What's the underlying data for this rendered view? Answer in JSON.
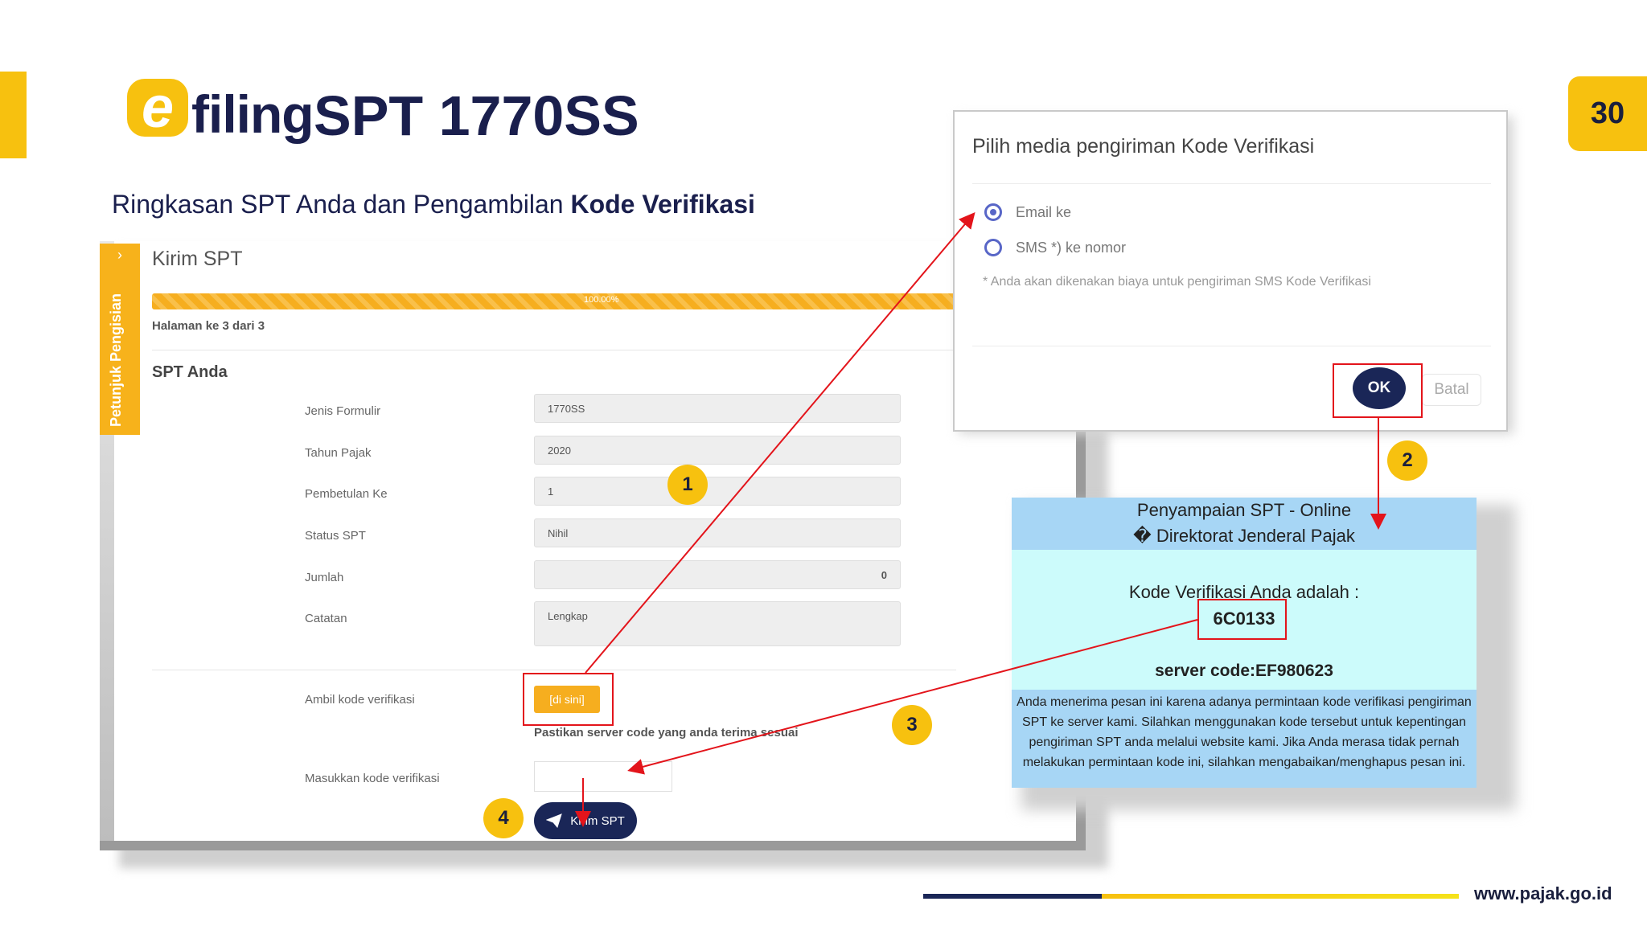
{
  "slide": {
    "page_number": "30",
    "logo_letter": "e",
    "logo_word": "filing",
    "title": "SPT 1770SS",
    "subtitle_plain": "Ringkasan SPT Anda dan Pengambilan ",
    "subtitle_bold": "Kode Verifikasi",
    "website": "www.pajak.go.id"
  },
  "form": {
    "guide_chevron": "›",
    "guide_tab": "Petunjuk Pengisian",
    "title": "Kirim SPT",
    "progress": {
      "label": "100.00%",
      "percent": 100
    },
    "page_info": "Halaman ke 3 dari 3",
    "section_title": "SPT Anda",
    "fields": [
      {
        "label": "Jenis Formulir",
        "value": "1770SS"
      },
      {
        "label": "Tahun Pajak",
        "value": "2020"
      },
      {
        "label": "Pembetulan Ke",
        "value": "1"
      },
      {
        "label": "Status SPT",
        "value": "Nihil"
      },
      {
        "label": "Jumlah",
        "value": "0"
      },
      {
        "label": "Catatan",
        "value": "Lengkap"
      }
    ],
    "get_code_label": "Ambil kode verifikasi",
    "get_code_button": "[di sini]",
    "server_note": "Pastikan server code yang anda terima sesuai",
    "enter_code_label": "Masukkan kode verifikasi",
    "enter_code_value": "",
    "send_button": "Kirim SPT"
  },
  "modal": {
    "title": "Pilih media pengiriman Kode Verifikasi",
    "options": [
      {
        "label": "Email ke",
        "selected": true
      },
      {
        "label": "SMS *) ke nomor",
        "selected": false
      }
    ],
    "sms_note": "* Anda akan dikenakan biaya untuk pengiriman SMS Kode Verifikasi",
    "ok_button": "OK",
    "cancel_button": "Batal"
  },
  "email": {
    "header_line1": "Penyampaian SPT - Online",
    "header_line2": "� Direktorat Jenderal Pajak",
    "code_label": "Kode Verifikasi Anda adalah :",
    "code_value": "6C0133",
    "server_code": "server code:EF980623",
    "footer_text": "Anda menerima pesan ini karena adanya permintaan kode verifikasi pengiriman SPT ke server kami. Silahkan menggunakan kode tersebut untuk kepentingan pengiriman SPT anda melalui website kami. Jika Anda merasa tidak pernah melakukan permintaan kode ini, silahkan mengabaikan/menghapus pesan ini."
  },
  "steps": [
    "1",
    "2",
    "3",
    "4"
  ],
  "colors": {
    "accent_yellow": "#f7c10f",
    "navy": "#1a2657",
    "highlight_red": "#e3141b",
    "email_blue": "#a7d6f5",
    "email_cyan": "#ccfbfb"
  },
  "icons": {
    "send_button": "paper-plane-icon",
    "guide_tab": "chevron-right-icon"
  }
}
